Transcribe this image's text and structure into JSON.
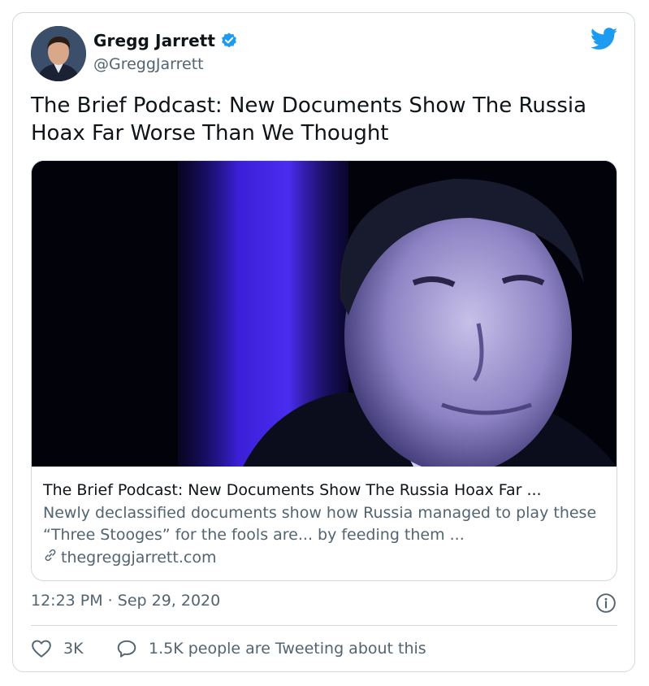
{
  "tweet": {
    "author": {
      "name": "Gregg Jarrett",
      "handle": "@GreggJarrett",
      "verified": true
    },
    "text": "The Brief Podcast: New Documents Show The Russia Hoax Far Worse Than We Thought",
    "link_card": {
      "title": "The Brief Podcast: New Documents Show The Russia Hoax Far ...",
      "description": "Newly declassified documents show how Russia managed to play these “Three Stooges” for the fools are... by feeding them ...",
      "domain": "thegreggjarrett.com"
    },
    "timestamp": "12:23 PM · Sep 29, 2020",
    "actions": {
      "like_count": "3K",
      "reply_text": "1.5K people are Tweeting about this"
    }
  },
  "icons": [
    "verified-badge-icon",
    "twitter-bird-icon",
    "link-icon",
    "info-icon",
    "heart-icon",
    "speech-bubble-icon"
  ],
  "colors": {
    "twitter_blue": "#1d9bf0",
    "text_primary": "#0f1419",
    "text_secondary": "#536471",
    "border": "#cfd9de"
  }
}
